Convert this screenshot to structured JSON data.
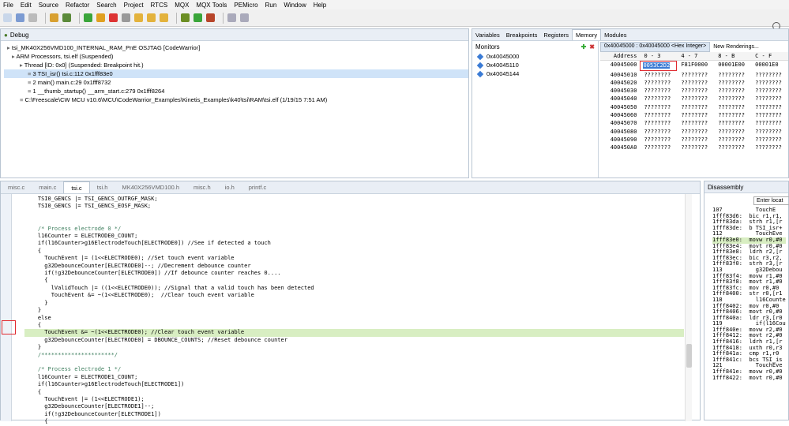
{
  "menu": [
    "File",
    "Edit",
    "Source",
    "Refactor",
    "Search",
    "Project",
    "RTCS",
    "MQX",
    "MQX Tools",
    "PEMicro",
    "Run",
    "Window",
    "Help"
  ],
  "debug": {
    "title": "Debug",
    "tree": [
      "tsi_MK40X256VMD100_INTERNAL_RAM_PnE OSJTAG [CodeWarrior]",
      "ARM Processors, tsi.elf (Suspended)",
      "Thread [ID: 0x0] (Suspended: Breakpoint hit.)",
      "3 TSI_isr() tsi.c:112 0x1fff83e0",
      "2 main() main.c:29 0x1fff8732",
      "1 __thumb_startup() __arm_start.c:279 0x1fff8264",
      "C:\\Freescale\\CW MCU v10.6\\MCU\\CodeWarrior_Examples\\Kinetis_Examples\\k40\\tsi\\RAM\\tsi.elf (1/19/15 7:51 AM)"
    ]
  },
  "memory": {
    "tabs": [
      "Variables",
      "Breakpoints",
      "Registers",
      "Memory",
      "Modules"
    ],
    "monitors_title": "Monitors",
    "monitors": [
      "0x40045000",
      "0x40045110",
      "0x40045144"
    ],
    "rendering_tab": "0x40045000 : 0x40045000 <Hex Integer>",
    "new_renderings": "New Renderings...",
    "columns": [
      "Address",
      "0 - 3",
      "4 - 7",
      "8 - B",
      "C - F"
    ],
    "rows": [
      [
        "40045000",
        "0053C2D2",
        "F81F0000",
        "00001E00",
        "00001E0"
      ],
      [
        "40045010",
        "????????",
        "????????",
        "????????",
        "????????"
      ],
      [
        "40045020",
        "????????",
        "????????",
        "????????",
        "????????"
      ],
      [
        "40045030",
        "????????",
        "????????",
        "????????",
        "????????"
      ],
      [
        "40045040",
        "????????",
        "????????",
        "????????",
        "????????"
      ],
      [
        "40045050",
        "????????",
        "????????",
        "????????",
        "????????"
      ],
      [
        "40045060",
        "????????",
        "????????",
        "????????",
        "????????"
      ],
      [
        "40045070",
        "????????",
        "????????",
        "????????",
        "????????"
      ],
      [
        "40045080",
        "????????",
        "????????",
        "????????",
        "????????"
      ],
      [
        "40045090",
        "????????",
        "????????",
        "????????",
        "????????"
      ],
      [
        "400450A0",
        "????????",
        "????????",
        "????????",
        "????????"
      ]
    ]
  },
  "editor": {
    "tabs": [
      "misc.c",
      "main.c",
      "tsi.c",
      "tsi.h",
      "MK40X256VMD100.h",
      "misc.h",
      "io.h",
      "printf.c"
    ],
    "active_tab": "tsi.c",
    "lines": [
      {
        "t": "    TSI0_GENCS |= TSI_GENCS_OUTRGF_MASK;",
        "k": "n"
      },
      {
        "t": "    TSI0_GENCS |= TSI_GENCS_EOSF_MASK;",
        "k": "n"
      },
      {
        "t": "",
        "k": "n"
      },
      {
        "t": "",
        "k": "n"
      },
      {
        "t": "    /* Process electrode 0 */",
        "k": "c"
      },
      {
        "t": "    l16Counter = ELECTRODE0_COUNT;",
        "k": "n"
      },
      {
        "t": "    if(l16Counter>g16ElectrodeTouch[ELECTRODE0]) //See if detected a touch",
        "k": "n"
      },
      {
        "t": "    {",
        "k": "n"
      },
      {
        "t": "      TouchEvent |= (1<<ELECTRODE0); //Set touch event variable",
        "k": "n"
      },
      {
        "t": "      g32DebounceCounter[ELECTRODE0]--; //Decrement debounce counter",
        "k": "n"
      },
      {
        "t": "      if(!g32DebounceCounter[ELECTRODE0]) //If debounce counter reaches 0....",
        "k": "n"
      },
      {
        "t": "      {",
        "k": "n"
      },
      {
        "t": "        lValidTouch |= ((1<<ELECTRODE0)); //Signal that a valid touch has been detected",
        "k": "n"
      },
      {
        "t": "        TouchEvent &= ~(1<<ELECTRODE0);  //Clear touch event variable",
        "k": "n"
      },
      {
        "t": "      }",
        "k": "n"
      },
      {
        "t": "    }",
        "k": "n"
      },
      {
        "t": "    else",
        "k": "n"
      },
      {
        "t": "    {",
        "k": "n"
      },
      {
        "t": "      TouchEvent &= ~(1<<ELECTRODE0); //Clear touch event variable",
        "k": "cur"
      },
      {
        "t": "      g32DebounceCounter[ELECTRODE0] = DBOUNCE_COUNTS; //Reset debounce counter",
        "k": "n"
      },
      {
        "t": "    }",
        "k": "n"
      },
      {
        "t": "    /**********************/",
        "k": "c"
      },
      {
        "t": "",
        "k": "n"
      },
      {
        "t": "    /* Process electrode 1 */",
        "k": "c"
      },
      {
        "t": "    l16Counter = ELECTRODE1_COUNT;",
        "k": "n"
      },
      {
        "t": "    if(l16Counter>g16ElectrodeTouch[ELECTRODE1])",
        "k": "n"
      },
      {
        "t": "    {",
        "k": "n"
      },
      {
        "t": "      TouchEvent |= (1<<ELECTRODE1);",
        "k": "n"
      },
      {
        "t": "      g32DebounceCounter[ELECTRODE1]--;",
        "k": "n"
      },
      {
        "t": "      if(!g32DebounceCounter[ELECTRODE1])",
        "k": "n"
      },
      {
        "t": "      {",
        "k": "n"
      }
    ]
  },
  "disassembly": {
    "title": "Disassembly",
    "enter_location": "Enter locat",
    "lines": [
      {
        "t": "107          TouchE",
        "k": "n"
      },
      {
        "t": "1fff83d6:  bic r1,r1,",
        "k": "n"
      },
      {
        "t": "1fff83da:  strh r1,[r",
        "k": "n"
      },
      {
        "t": "1fff83de:  b TSI_isr+",
        "k": "n"
      },
      {
        "t": "112          TouchEve",
        "k": "n"
      },
      {
        "t": "1fff83e0:  movw r0,#0",
        "k": "cur"
      },
      {
        "t": "1fff83e4:  movt r0,#0",
        "k": "n"
      },
      {
        "t": "1fff83e8:  ldrh r2,[r",
        "k": "n"
      },
      {
        "t": "1fff83ec:  bic r3,r2,",
        "k": "n"
      },
      {
        "t": "1fff83f0:  strh r3,[r",
        "k": "n"
      },
      {
        "t": "113          g32Debou",
        "k": "n"
      },
      {
        "t": "1fff83f4:  movw r1,#0",
        "k": "n"
      },
      {
        "t": "1fff83f8:  movt r1,#0",
        "k": "n"
      },
      {
        "t": "1fff83fc:  mov r0,#0",
        "k": "n"
      },
      {
        "t": "1fff8400:  str r0,[r1",
        "k": "n"
      },
      {
        "t": "118          l16Counte",
        "k": "n"
      },
      {
        "t": "1fff8402:  mov r0,#0",
        "k": "n"
      },
      {
        "t": "1fff8406:  movt r0,#0",
        "k": "n"
      },
      {
        "t": "1fff840a:  ldr r3,[r0",
        "k": "n"
      },
      {
        "t": "119          if(l16Cou",
        "k": "n"
      },
      {
        "t": "1fff840e:  movw r2,#0",
        "k": "n"
      },
      {
        "t": "1fff8412:  movt r2,#0",
        "k": "n"
      },
      {
        "t": "1fff8416:  ldrh r1,[r",
        "k": "n"
      },
      {
        "t": "1fff8418:  uxth r0,r3",
        "k": "n"
      },
      {
        "t": "1fff841a:  cmp r1,r0",
        "k": "n"
      },
      {
        "t": "1fff841c:  bcs TSI_is",
        "k": "n"
      },
      {
        "t": "121          TouchEve",
        "k": "n"
      },
      {
        "t": "1fff841e:  movw r0,#0",
        "k": "n"
      },
      {
        "t": "1fff8422:  movt r0,#0",
        "k": "n"
      }
    ]
  }
}
